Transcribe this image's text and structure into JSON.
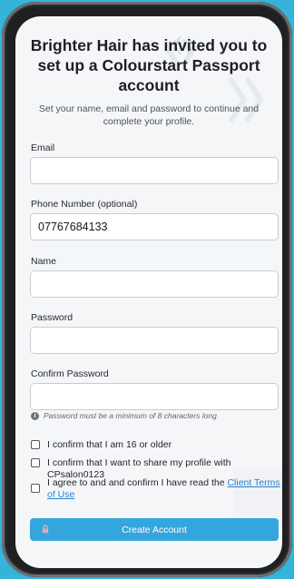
{
  "header": {
    "title": "Brighter Hair has invited you to set up a Colourstart Passport account",
    "subtitle": "Set your name, email and password to continue and complete your profile."
  },
  "form": {
    "email": {
      "label": "Email",
      "value": "",
      "placeholder": ""
    },
    "phone": {
      "label": "Phone Number (optional)",
      "value": "07767684133",
      "placeholder": ""
    },
    "name": {
      "label": "Name",
      "value": "",
      "placeholder": ""
    },
    "password": {
      "label": "Password",
      "value": "",
      "placeholder": ""
    },
    "confirm_password": {
      "label": "Confirm Password",
      "value": "",
      "placeholder": ""
    },
    "password_hint": "Password must be a minimum of 8 characters long",
    "password_hint_icon": "info-icon"
  },
  "checks": {
    "age": {
      "text": "I confirm that I am 16 or older",
      "checked": false
    },
    "share": {
      "text": "I confirm that I want to share my profile with CPsalon0123",
      "checked": false
    },
    "terms": {
      "text_before": "I agree to and and confirm I have read the ",
      "link_text": "Client Terms of Use",
      "checked": false
    }
  },
  "actions": {
    "create_label": "Create Account",
    "create_icon": "lock-icon"
  },
  "colors": {
    "background": "#36b3d9",
    "accent": "#34a6dd",
    "link": "#2b7fd0"
  }
}
